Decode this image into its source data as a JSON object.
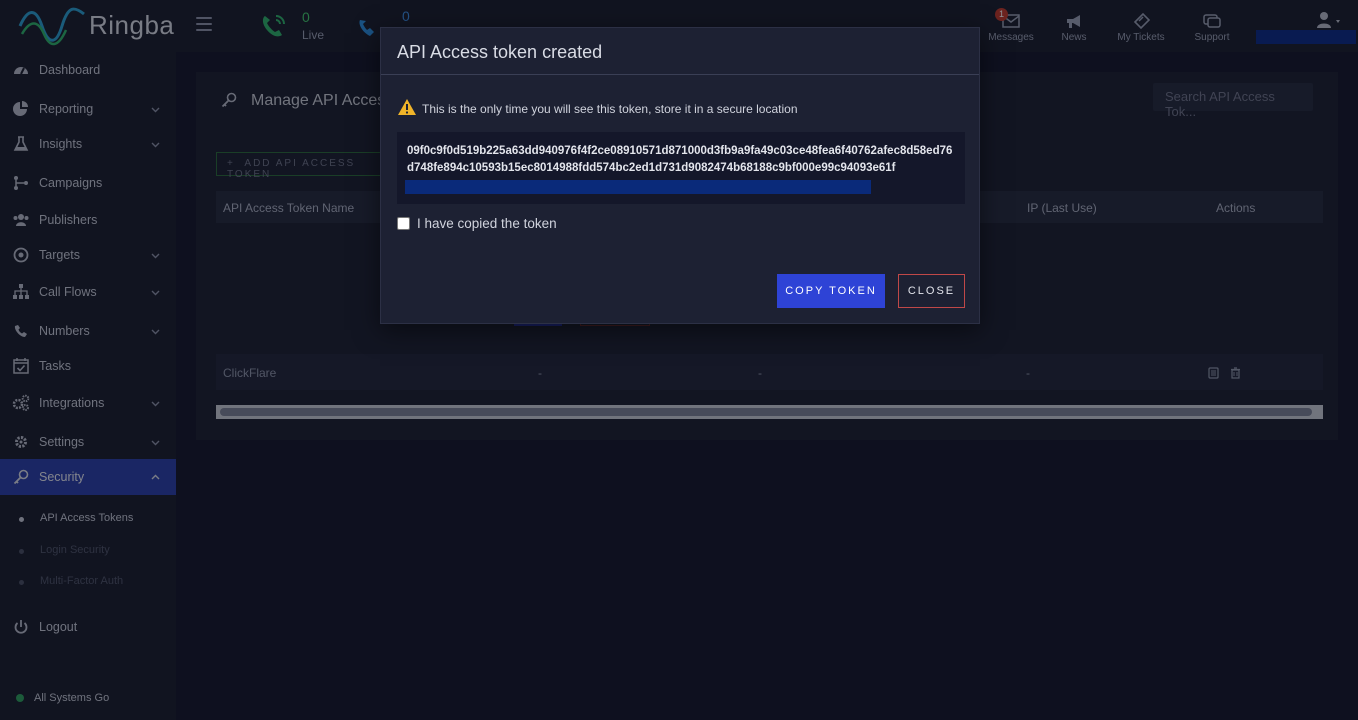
{
  "app": {
    "logo_text": "Ringba"
  },
  "header": {
    "live_count": "0",
    "live_label": "Live",
    "second_count": "0",
    "messages": {
      "label": "Messages",
      "badge": "1"
    },
    "news": {
      "label": "News"
    },
    "tickets": {
      "label": "My Tickets"
    },
    "support": {
      "label": "Support"
    }
  },
  "sidebar": {
    "items": [
      {
        "label": "Dashboard",
        "icon": "dashboard-icon"
      },
      {
        "label": "Reporting",
        "icon": "reporting-icon"
      },
      {
        "label": "Insights",
        "icon": "flask-icon"
      },
      {
        "label": "Campaigns",
        "icon": "campaigns-icon"
      },
      {
        "label": "Publishers",
        "icon": "users-icon"
      },
      {
        "label": "Targets",
        "icon": "target-icon"
      },
      {
        "label": "Call Flows",
        "icon": "sitemap-icon"
      },
      {
        "label": "Numbers",
        "icon": "phone-icon"
      },
      {
        "label": "Tasks",
        "icon": "calendar-check-icon"
      },
      {
        "label": "Integrations",
        "icon": "cogs-icon"
      },
      {
        "label": "Settings",
        "icon": "gear-icon"
      },
      {
        "label": "Security",
        "icon": "key-icon"
      }
    ],
    "security_sub": [
      {
        "label": "API Access Tokens"
      },
      {
        "label": "Login Security"
      },
      {
        "label": "Multi-Factor Auth"
      }
    ],
    "logout": "Logout",
    "status": "All Systems Go"
  },
  "page": {
    "title": "Manage API Access Tokens",
    "search_placeholder": "Search API Access Tok...",
    "add_button": "ADD API ACCESS TOKEN",
    "columns": [
      "API Access Token Name",
      "IP (Last Use)",
      "Actions"
    ],
    "rows": [
      {
        "name": "ClickFlare",
        "c2": "-",
        "c3": "-",
        "ip": "-"
      }
    ]
  },
  "modal": {
    "title": "API Access token created",
    "warning": "This is the only time you will see this token, store it in a secure location",
    "token": "09f0c9f0d519b225a63dd940976f4f2ce08910571d871000d3fb9a9fa49c03ce48fea6f40762afec8d58ed76d748fe894c10593b15ec8014988fdd574bc2ed1d731d9082474b68188c9bf000e99c94093e61f",
    "checkbox_label": "I have copied the token",
    "copy_button": "COPY TOKEN",
    "close_button": "CLOSE"
  },
  "colors": {
    "accent": "#2e43d6",
    "active_nav": "#2b3fa8",
    "live_green": "#42c86b",
    "danger": "#c04848"
  }
}
